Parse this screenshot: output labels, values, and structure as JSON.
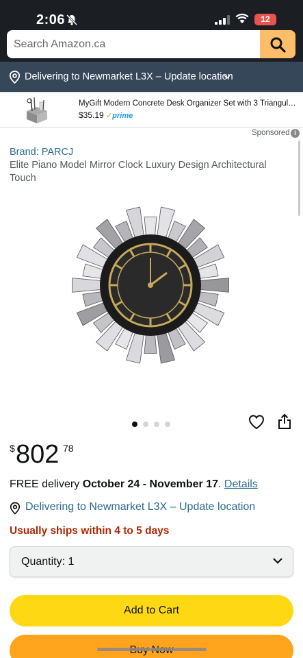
{
  "status_bar": {
    "time": "2:06",
    "battery": "12"
  },
  "search": {
    "placeholder": "Search Amazon.ca"
  },
  "delivery_bar": {
    "text": "Delivering to Newmarket L3X – Update location"
  },
  "ad": {
    "title": "MyGift Modern Concrete Desk Organizer Set with 3 Triangul…",
    "price": "$35.19",
    "prime": "prime"
  },
  "sponsored_label": "Sponsored",
  "product": {
    "brand": "Brand: PARCJ",
    "title": "Elite Piano Model Mirror Clock Luxury Design Architectural Touch",
    "image_count": 4,
    "active_image": 1
  },
  "price": {
    "currency": "$",
    "whole": "802",
    "fraction": "78"
  },
  "delivery": {
    "prefix": "FREE delivery ",
    "dates": "October 24 - November 17",
    "suffix": ". ",
    "details_link": "Details"
  },
  "location_line": "Delivering to Newmarket L3X – Update location",
  "availability": "Usually ships within 4 to 5 days",
  "quantity": {
    "label": "Quantity:",
    "value": "1"
  },
  "buttons": {
    "add_to_cart": "Add to Cart",
    "buy_now": "Buy Now"
  },
  "colors": {
    "header_bg": "#1b1f23",
    "delivery_bar_bg": "#37475a",
    "link": "#2b6c8f",
    "availability": "#b12704",
    "add_to_cart": "#ffd814",
    "buy_now": "#ffa41c",
    "search_button": "#febd69"
  },
  "icons": [
    "bell-slash-icon",
    "signal-icon",
    "wifi-icon",
    "battery-icon",
    "search-icon",
    "location-pin-icon",
    "chevron-down-icon",
    "info-icon",
    "heart-icon",
    "share-icon"
  ]
}
